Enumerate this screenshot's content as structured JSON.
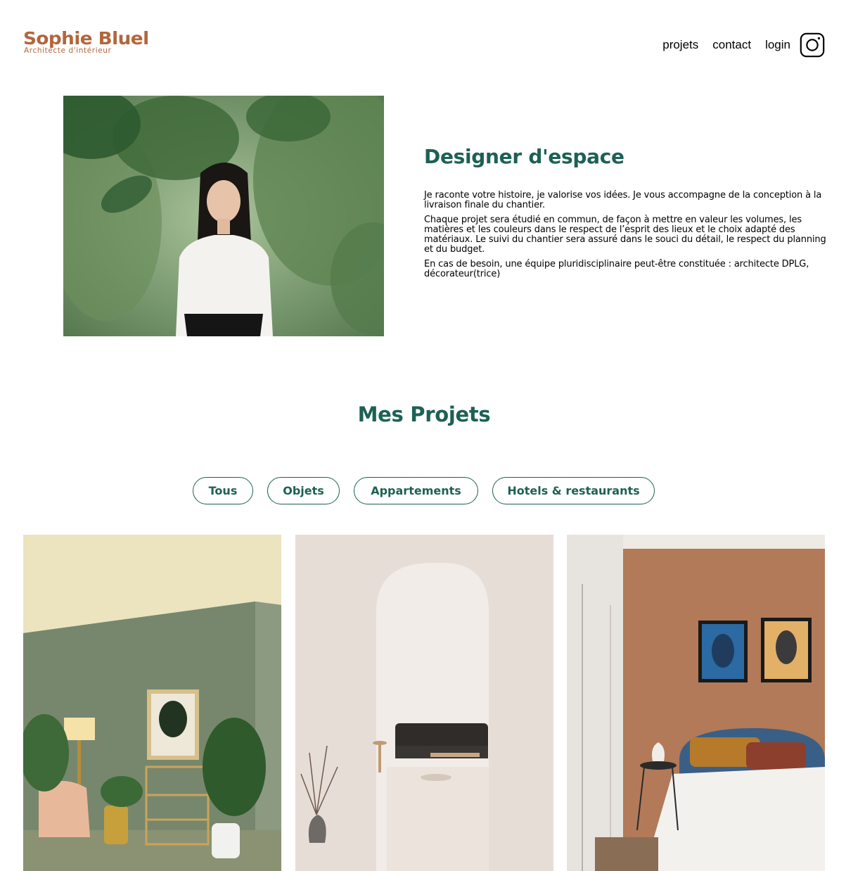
{
  "header": {
    "brand_name": "Sophie Bluel",
    "brand_subtitle": "Architecte d'intérieur",
    "nav": {
      "projets": "projets",
      "contact": "contact",
      "login": "login"
    },
    "instagram_icon": "instagram-icon"
  },
  "intro": {
    "title": "Designer d'espace",
    "paragraphs": [
      "Je raconte votre histoire, je valorise vos idées. Je vous accompagne de la conception à la livraison finale du chantier.",
      "Chaque projet sera étudié en commun, de façon à mettre en valeur les volumes, les matières et les couleurs dans le respect de l’esprit des lieux et le choix adapté des matériaux. Le suivi du chantier sera assuré dans le souci du détail, le respect du planning et du budget.",
      "En cas de besoin, une équipe pluridisciplinaire peut-être constituée : architecte DPLG, décorateur(trice)"
    ]
  },
  "projects": {
    "title": "Mes Projets",
    "filters": [
      "Tous",
      "Objets",
      "Appartements",
      "Hotels & restaurants"
    ]
  },
  "colors": {
    "accent_green": "#1d6154",
    "brand_brown": "#b1663c"
  }
}
